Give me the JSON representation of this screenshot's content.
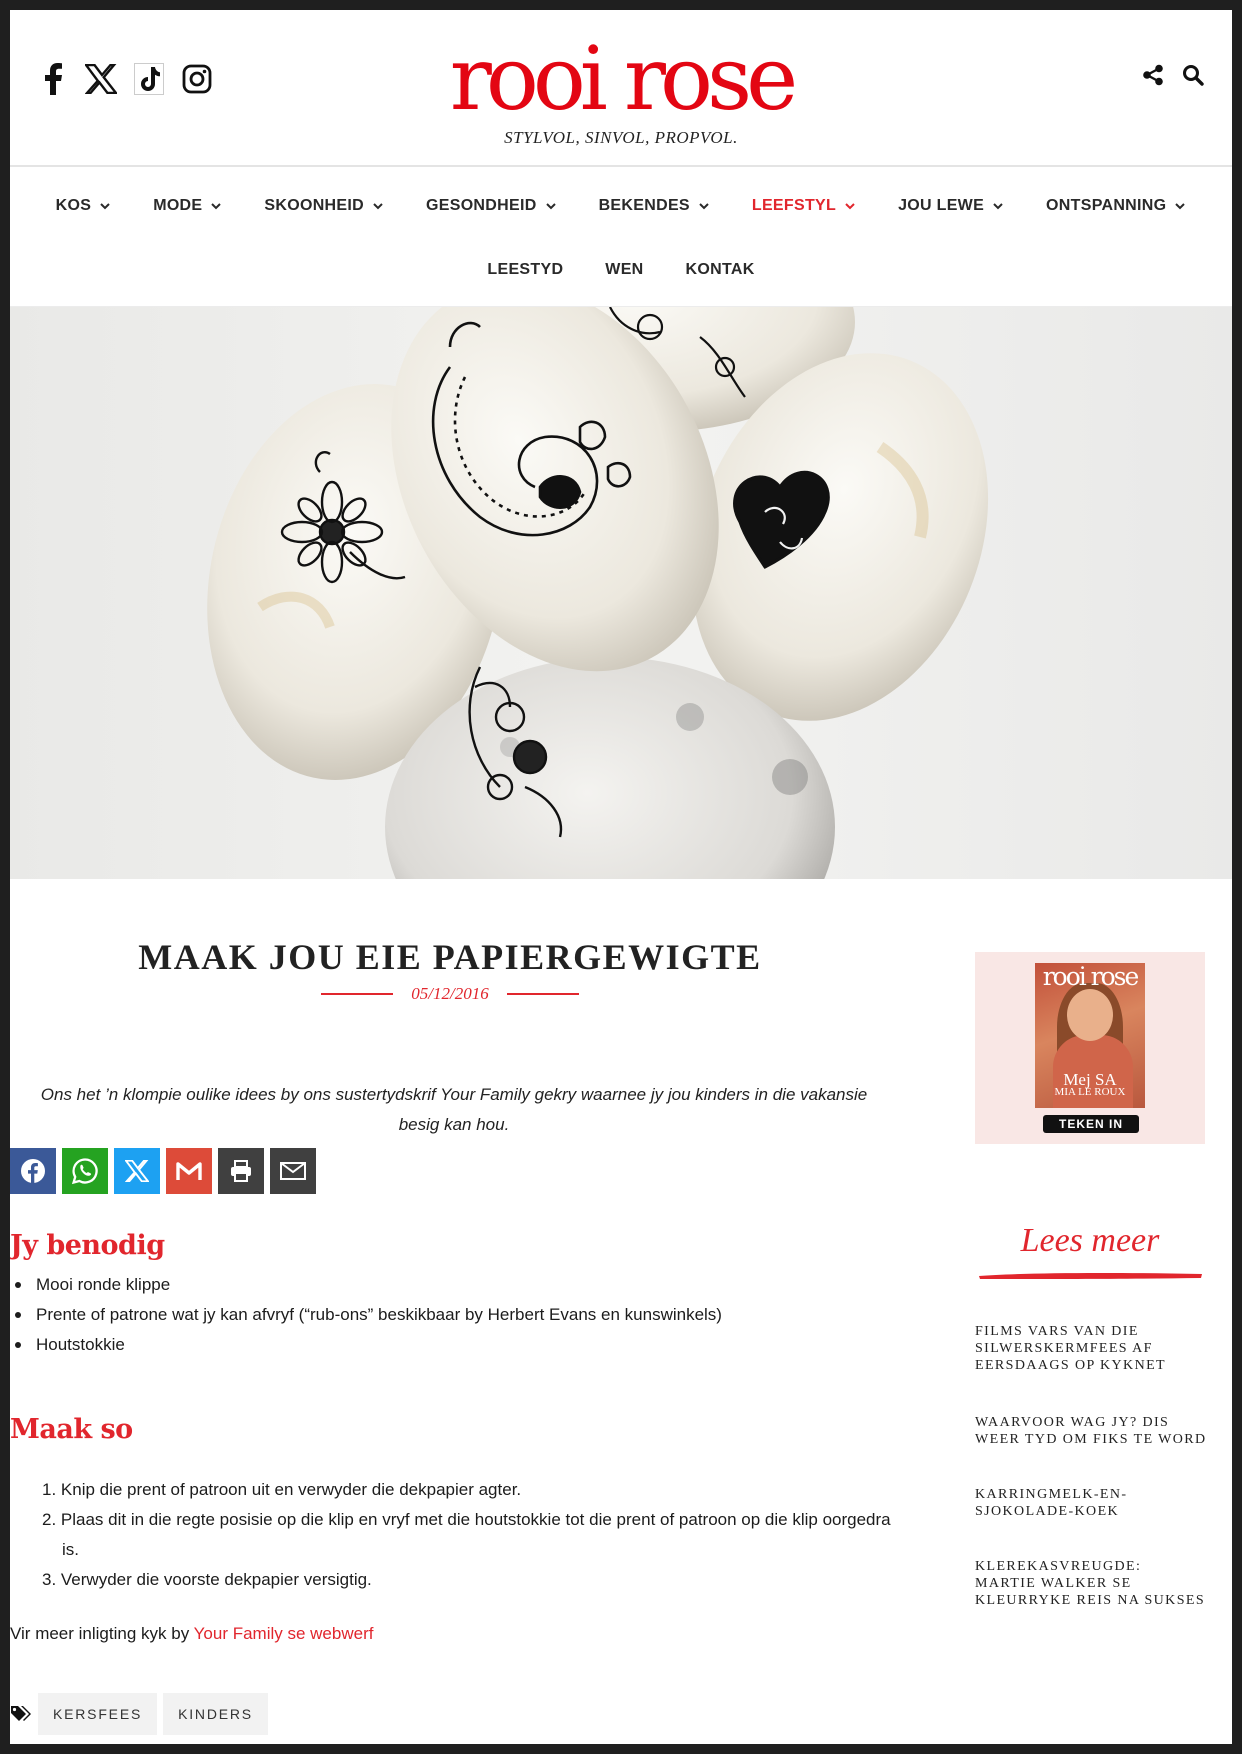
{
  "header": {
    "logo": "rooi rose",
    "tagline": "STYLVOL, SINVOL, PROPVOL.",
    "social_icons": [
      "facebook-icon",
      "x-icon",
      "tiktok-icon",
      "instagram-icon"
    ],
    "tool_icons": [
      "share-icon",
      "search-icon"
    ]
  },
  "nav": {
    "row1": [
      {
        "label": "KOS",
        "dropdown": true
      },
      {
        "label": "MODE",
        "dropdown": true
      },
      {
        "label": "SKOONHEID",
        "dropdown": true
      },
      {
        "label": "GESONDHEID",
        "dropdown": true
      },
      {
        "label": "BEKENDES",
        "dropdown": true
      },
      {
        "label": "LEEFSTYL",
        "dropdown": true,
        "active": true
      },
      {
        "label": "JOU LEWE",
        "dropdown": true
      },
      {
        "label": "ONTSPANNING",
        "dropdown": true
      }
    ],
    "row2": [
      {
        "label": "LEESTYD"
      },
      {
        "label": "WEN"
      },
      {
        "label": "KONTAK"
      }
    ]
  },
  "article": {
    "title": "MAAK JOU EIE PAPIERGEWIGTE",
    "date": "05/12/2016",
    "intro": "Ons het ’n klompie oulike idees by ons sustertydskrif Your Family gekry waarnee jy jou kinders in die vakansie besig kan hou.",
    "share_icons": [
      "facebook-icon",
      "whatsapp-icon",
      "x-icon",
      "gmail-icon",
      "print-icon",
      "email-icon"
    ],
    "section1_title": "Jy benodig",
    "needs": [
      "Mooi ronde klippe",
      "Prente of patrone wat jy kan afvryf (“rub-ons” beskikbaar by Herbert Evans en kunswinkels)",
      "Houtstokkie"
    ],
    "section2_title": "Maak so",
    "steps": [
      "1. Knip die prent of patroon uit en verwyder die dekpapier agter.",
      "2. Plaas dit in die regte posisie op die klip en vryf met die houtstokkie tot die prent of patroon op die klip oorgedra is.",
      "3. Verwyder die voorste dekpapier versigtig."
    ],
    "more_prefix": "Vir meer inligting kyk by ",
    "more_link": "Your Family se webwerf",
    "tags": [
      "KERSFEES",
      "KINDERS"
    ]
  },
  "sidebar": {
    "cover_logo": "rooi rose",
    "cover_name": "Mej SA",
    "cover_sub": "MIA LE ROUX",
    "subscribe_label": "TEKEN IN",
    "lees_meer": "Lees meer",
    "links": [
      "FILMS VARS VAN DIE SILWERSKERMFEES AF EERSDAAGS OP KYKNET",
      "WAARVOOR WAG JY? DIS WEER TYD OM FIKS TE WORD",
      "KARRINGMELK-EN-SJOKOLADE-KOEK",
      "KLEREKASVREUGDE: MARTIE WALKER SE KLEURRYKE REIS NA SUKSES"
    ]
  },
  "colors": {
    "brand_red": "#e1262d",
    "facebook": "#3b5998",
    "whatsapp": "#25a321",
    "x": "#1da1f2",
    "gmail": "#dd4b39",
    "print": "#404040",
    "email": "#404040"
  }
}
